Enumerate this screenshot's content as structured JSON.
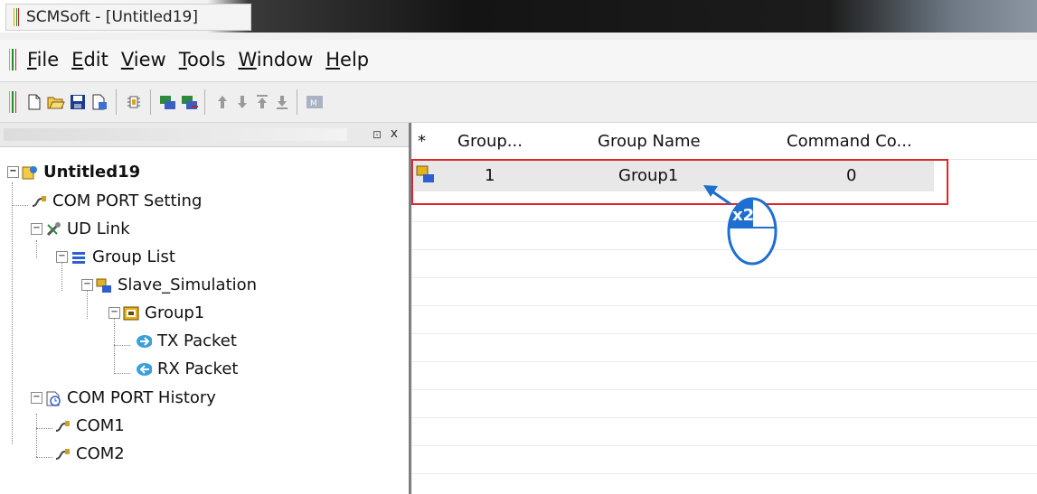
{
  "window": {
    "title": "SCMSoft - [Untitled19]"
  },
  "menu": {
    "items": [
      "File",
      "Edit",
      "View",
      "Tools",
      "Window",
      "Help"
    ]
  },
  "toolbar": {
    "buttons": [
      "new-icon",
      "open-icon",
      "save-icon",
      "close-file-icon",
      "settings-icon",
      "connect-icon",
      "disconnect-icon",
      "move-up-icon",
      "move-down-icon",
      "move-top-icon",
      "move-bottom-icon",
      "monitor-icon"
    ],
    "last_label": "M"
  },
  "left_pane": {
    "pin_label": "⊡",
    "close_label": "x",
    "tree": {
      "root": "Untitled19",
      "com_port_setting": "COM PORT Setting",
      "ud_link": "UD Link",
      "group_list": "Group List",
      "slave_simulation": "Slave_Simulation",
      "group1": "Group1",
      "tx_packet": "TX Packet",
      "rx_packet": "RX Packet",
      "com_port_history": "COM PORT History",
      "com1": "COM1",
      "com2": "COM2"
    }
  },
  "grid": {
    "columns": [
      "*",
      "Group...",
      "Group Name",
      "Command Co..."
    ],
    "rows": [
      {
        "number": "1",
        "name": "Group1",
        "command_count": "0"
      }
    ]
  },
  "annotation": {
    "label": "x2"
  },
  "colors": {
    "highlight_border": "#e0262b",
    "annotation_blue": "#1f6fd0"
  }
}
